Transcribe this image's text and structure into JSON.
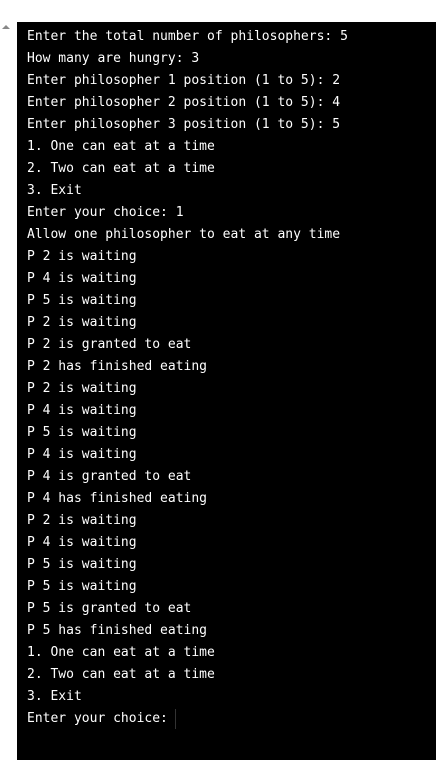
{
  "terminal": {
    "lines": [
      "Enter the total number of philosophers: 5",
      "How many are hungry: 3",
      "Enter philosopher 1 position (1 to 5): 2",
      "Enter philosopher 2 position (1 to 5): 4",
      "Enter philosopher 3 position (1 to 5): 5",
      "1. One can eat at a time",
      "2. Two can eat at a time",
      "3. Exit",
      "Enter your choice: 1",
      "Allow one philosopher to eat at any time",
      "P 2 is waiting",
      "P 4 is waiting",
      "P 5 is waiting",
      "P 2 is waiting",
      "P 2 is granted to eat",
      "P 2 has finished eating",
      "P 2 is waiting",
      "P 4 is waiting",
      "P 5 is waiting",
      "P 4 is waiting",
      "P 4 is granted to eat",
      "P 4 has finished eating",
      "P 2 is waiting",
      "P 4 is waiting",
      "P 5 is waiting",
      "P 5 is waiting",
      "P 5 is granted to eat",
      "P 5 has finished eating",
      "1. One can eat at a time",
      "2. Two can eat at a time",
      "3. Exit"
    ],
    "prompt": "Enter your choice:"
  },
  "colors": {
    "terminal_background": "#000000",
    "terminal_text": "#ffffff"
  }
}
